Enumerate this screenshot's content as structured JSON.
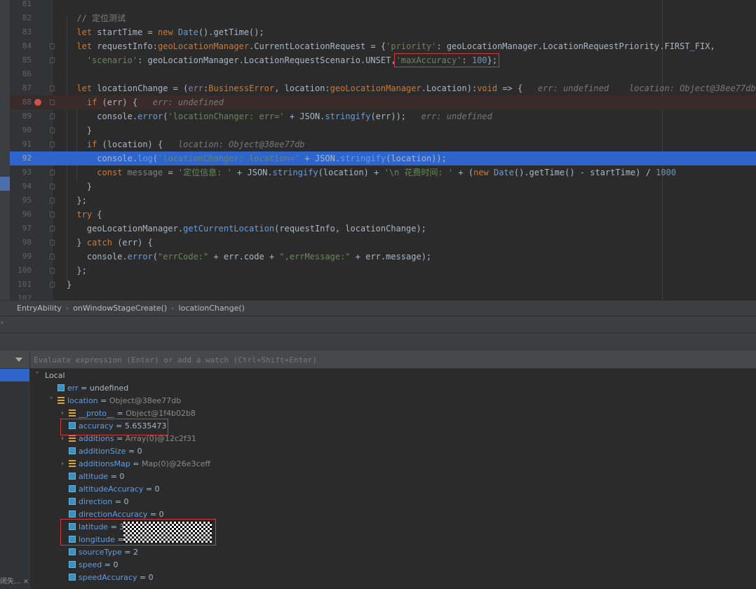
{
  "editor": {
    "lines": [
      {
        "num": "81",
        "tokens": []
      },
      {
        "num": "82",
        "tokens": [
          {
            "t": "// 定位测试",
            "c": "cmt"
          }
        ]
      },
      {
        "num": "83",
        "tokens": [
          {
            "t": "let ",
            "c": "kw"
          },
          {
            "t": "startTime = "
          },
          {
            "t": "new ",
            "c": "kw"
          },
          {
            "t": "Date",
            "c": "mth"
          },
          {
            "t": "().getTime();"
          }
        ]
      },
      {
        "num": "84",
        "tokens": [
          {
            "t": "let ",
            "c": "kw"
          },
          {
            "t": "requestInfo:"
          },
          {
            "t": "geoLocationManager",
            "c": "typ"
          },
          {
            "t": ".CurrentLocationRequest = {"
          },
          {
            "t": "'priority'",
            "c": "str"
          },
          {
            "t": ": geoLocationManager.LocationRequestPriority.FIRST_FIX,"
          }
        ]
      },
      {
        "num": "85",
        "tokens": [
          {
            "t": "  "
          },
          {
            "t": "'scenario'",
            "c": "str"
          },
          {
            "t": ": geoLocationManager.LocationRequestScenario.UNSET,"
          },
          {
            "t": "'maxAccuracy'",
            "c": "str",
            "box": true
          },
          {
            "t": ": ",
            "box": true
          },
          {
            "t": "100",
            "c": "num-l",
            "box": true
          },
          {
            "t": "};",
            "box": true
          }
        ]
      },
      {
        "num": "86",
        "tokens": []
      },
      {
        "num": "87",
        "tokens": [
          {
            "t": "let ",
            "c": "kw"
          },
          {
            "t": "locationChange = ("
          },
          {
            "t": "err",
            "c": "prop"
          },
          {
            "t": ":"
          },
          {
            "t": "BusinessError",
            "c": "typ"
          },
          {
            "t": ", location:"
          },
          {
            "t": "geoLocationManager",
            "c": "typ"
          },
          {
            "t": ".Location):"
          },
          {
            "t": "void",
            "c": "kw"
          },
          {
            "t": " => {   "
          },
          {
            "t": "err: undefined    location: Object@38ee77db",
            "c": "hint"
          }
        ]
      },
      {
        "num": "88",
        "tokens": [
          {
            "t": "  "
          },
          {
            "t": "if ",
            "c": "kw"
          },
          {
            "t": "(err) {   "
          },
          {
            "t": "err: undefined",
            "c": "hint"
          }
        ]
      },
      {
        "num": "89",
        "tokens": [
          {
            "t": "    console."
          },
          {
            "t": "error",
            "c": "mth"
          },
          {
            "t": "("
          },
          {
            "t": "'locationChanger: err='",
            "c": "str"
          },
          {
            "t": " + JSON."
          },
          {
            "t": "stringify",
            "c": "mth"
          },
          {
            "t": "(err));   "
          },
          {
            "t": "err: undefined",
            "c": "hint"
          }
        ]
      },
      {
        "num": "90",
        "tokens": [
          {
            "t": "  }"
          }
        ]
      },
      {
        "num": "91",
        "tokens": [
          {
            "t": "  "
          },
          {
            "t": "if ",
            "c": "kw"
          },
          {
            "t": "(location) {   "
          },
          {
            "t": "location: Object@38ee77db",
            "c": "hint"
          }
        ]
      },
      {
        "num": "92",
        "tokens": [
          {
            "t": "    console."
          },
          {
            "t": "log",
            "c": "mth"
          },
          {
            "t": "("
          },
          {
            "t": "'locationChanger: location='",
            "c": "str"
          },
          {
            "t": " + JSON."
          },
          {
            "t": "stringify",
            "c": "mth"
          },
          {
            "t": "(location));"
          }
        ]
      },
      {
        "num": "93",
        "tokens": [
          {
            "t": "    "
          },
          {
            "t": "const ",
            "c": "kw"
          },
          {
            "t": "message",
            "c": "cmt"
          },
          {
            "t": " = "
          },
          {
            "t": "'定位信息: '",
            "c": "str"
          },
          {
            "t": " + JSON."
          },
          {
            "t": "stringify",
            "c": "mth"
          },
          {
            "t": "(location) + "
          },
          {
            "t": "'\\n 花费时间: '",
            "c": "str"
          },
          {
            "t": " + ("
          },
          {
            "t": "new ",
            "c": "kw"
          },
          {
            "t": "Date",
            "c": "mth"
          },
          {
            "t": "().getTime() - startTime) / "
          },
          {
            "t": "1000",
            "c": "num-l"
          }
        ]
      },
      {
        "num": "94",
        "tokens": [
          {
            "t": "  }"
          }
        ]
      },
      {
        "num": "95",
        "tokens": [
          {
            "t": "};"
          }
        ]
      },
      {
        "num": "96",
        "tokens": [
          {
            "t": "try ",
            "c": "kw"
          },
          {
            "t": "{"
          }
        ]
      },
      {
        "num": "97",
        "tokens": [
          {
            "t": "  geoLocationManager."
          },
          {
            "t": "getCurrentLocation",
            "c": "mth"
          },
          {
            "t": "(requestInfo, locationChange);"
          }
        ]
      },
      {
        "num": "98",
        "tokens": [
          {
            "t": "} "
          },
          {
            "t": "catch ",
            "c": "kw"
          },
          {
            "t": "(err) {"
          }
        ]
      },
      {
        "num": "99",
        "tokens": [
          {
            "t": "  console."
          },
          {
            "t": "error",
            "c": "mth"
          },
          {
            "t": "("
          },
          {
            "t": "\"errCode:\"",
            "c": "str"
          },
          {
            "t": " + err.code + "
          },
          {
            "t": "\",errMessage:\"",
            "c": "str"
          },
          {
            "t": " + err.message);"
          }
        ]
      },
      {
        "num": "100",
        "tokens": [
          {
            "t": "};"
          }
        ]
      },
      {
        "num": "101",
        "tokens": [
          {
            "t": "}"
          }
        ]
      },
      {
        "num": "102",
        "tokens": []
      }
    ]
  },
  "breadcrumb": {
    "items": [
      "EntryAbility",
      "onWindowStageCreate()",
      "locationChange()"
    ]
  },
  "debugger": {
    "evaluate_placeholder": "Evaluate expression (Enter) or add a watch (Ctrl+Shift+Enter)",
    "frame_label": "闭失...",
    "close_icon": "×",
    "scope_label": "Local",
    "variables": [
      {
        "name": "err",
        "eq": " = ",
        "value": "undefined",
        "icon": "prim",
        "level": 1
      },
      {
        "name": "location",
        "eq": " = ",
        "value": "Object@38ee77db",
        "icon": "obj",
        "level": 1,
        "expanded": true,
        "gray": true
      },
      {
        "name": "__proto__",
        "eq": " = ",
        "value": "Object@1f4b02b8",
        "icon": "obj",
        "level": 2,
        "collapsed": true,
        "gray": true
      },
      {
        "name": "accuracy",
        "eq": " = ",
        "value": "5.6535473",
        "icon": "prim",
        "level": 2
      },
      {
        "name": "additions",
        "eq": " = ",
        "value": "Array(0)@12c2f31",
        "icon": "obj",
        "level": 2,
        "collapsed": true,
        "gray": true
      },
      {
        "name": "additionSize",
        "eq": " = ",
        "value": "0",
        "icon": "prim",
        "level": 2
      },
      {
        "name": "additionsMap",
        "eq": " = ",
        "value": "Map(0)@26e3ceff",
        "icon": "obj",
        "level": 2,
        "collapsed": true,
        "gray": true
      },
      {
        "name": "altitude",
        "eq": " = ",
        "value": "0",
        "icon": "prim",
        "level": 2
      },
      {
        "name": "altitudeAccuracy",
        "eq": " = ",
        "value": "0",
        "icon": "prim",
        "level": 2
      },
      {
        "name": "direction",
        "eq": " = ",
        "value": "0",
        "icon": "prim",
        "level": 2
      },
      {
        "name": "directionAccuracy",
        "eq": " = ",
        "value": "0",
        "icon": "prim",
        "level": 2
      },
      {
        "name": "latitude",
        "eq": " = ",
        "value": "3",
        "icon": "prim",
        "level": 2
      },
      {
        "name": "longitude",
        "eq": " = ",
        "value": "",
        "icon": "prim",
        "level": 2
      },
      {
        "name": "sourceType",
        "eq": " = ",
        "value": "2",
        "icon": "prim",
        "level": 2
      },
      {
        "name": "speed",
        "eq": " = ",
        "value": "0",
        "icon": "prim",
        "level": 2
      },
      {
        "name": "speedAccuracy",
        "eq": " = ",
        "value": "0",
        "icon": "prim",
        "level": 2
      }
    ]
  },
  "colors": {
    "editor_bg": "#2b2b2b",
    "current_line": "#2f65ca",
    "breakpoint": "#c75450",
    "annotation_box": "#d13c3c"
  }
}
